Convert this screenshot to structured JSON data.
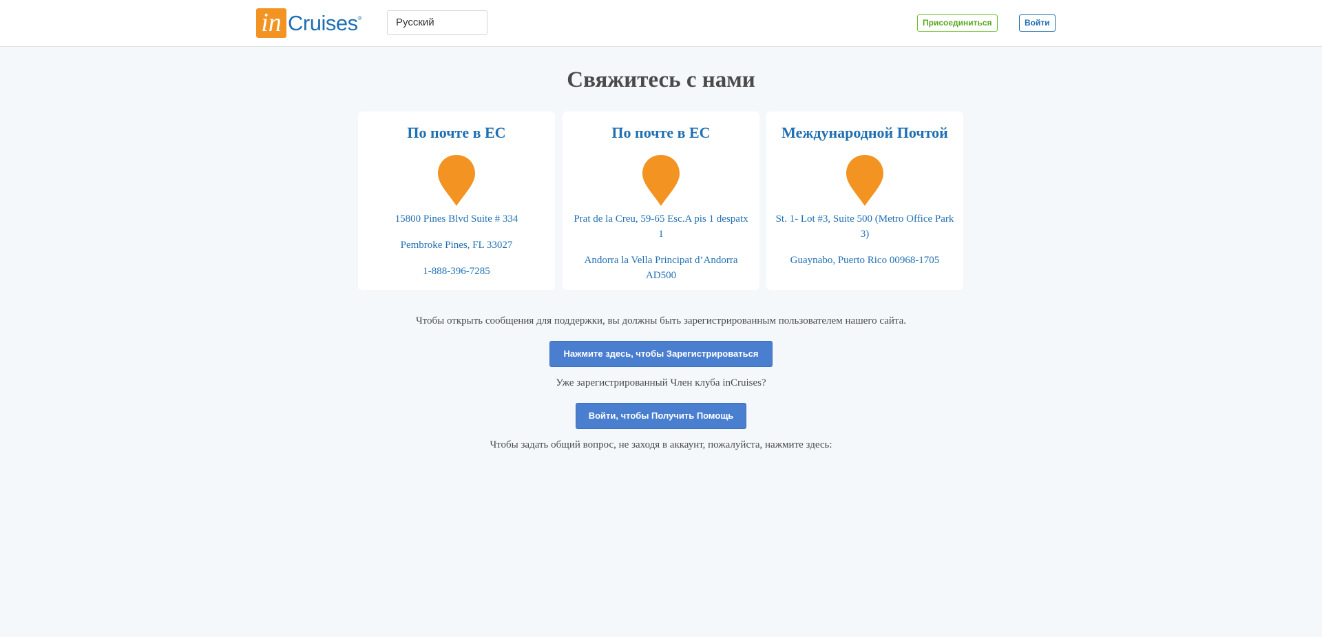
{
  "header": {
    "logo_in": "in",
    "logo_cruises": "Cruises",
    "logo_reg": "®",
    "language_selected": "Русский",
    "join_label": "Присоединиться",
    "login_label": "Войти"
  },
  "main": {
    "title": "Свяжитесь с нами",
    "cards": [
      {
        "title": "По почте в ЕС",
        "lines": [
          "15800 Pines Blvd Suite # 334",
          "Pembroke Pines, FL 33027",
          "1-888-396-7285"
        ]
      },
      {
        "title": "По почте в ЕС",
        "lines": [
          "Prat de la Creu, 59-65 Esc.A pis 1 despatx 1",
          "Andorra la Vella Principat d’Andorra AD500"
        ]
      },
      {
        "title": "Международной Почтой",
        "lines": [
          "St. 1- Lot #3, Suite 500 (Metro Office Park 3)",
          "Guaynabo, Puerto Rico 00968-1705"
        ]
      }
    ],
    "support_notice": "Чтобы открыть сообщения для поддержки, вы должны быть зарегистрированным пользователем нашего сайта.",
    "register_button": "Нажмите здесь, чтобы Зарегистрироваться",
    "already_member": "Уже зарегистрированный Член клуба inCruises?",
    "login_help_button": "Войти, чтобы Получить Помощь",
    "general_question": "Чтобы задать общий вопрос, не заходя в аккаунт, пожалуйста, нажмите здесь:"
  },
  "colors": {
    "brand_orange": "#f39321",
    "brand_blue": "#1f6fb3",
    "join_green": "#6cbf2a",
    "cta_blue": "#4a7fd0",
    "background": "#f4f8fb"
  },
  "icons": {
    "card_icon": "map-pin-icon"
  }
}
